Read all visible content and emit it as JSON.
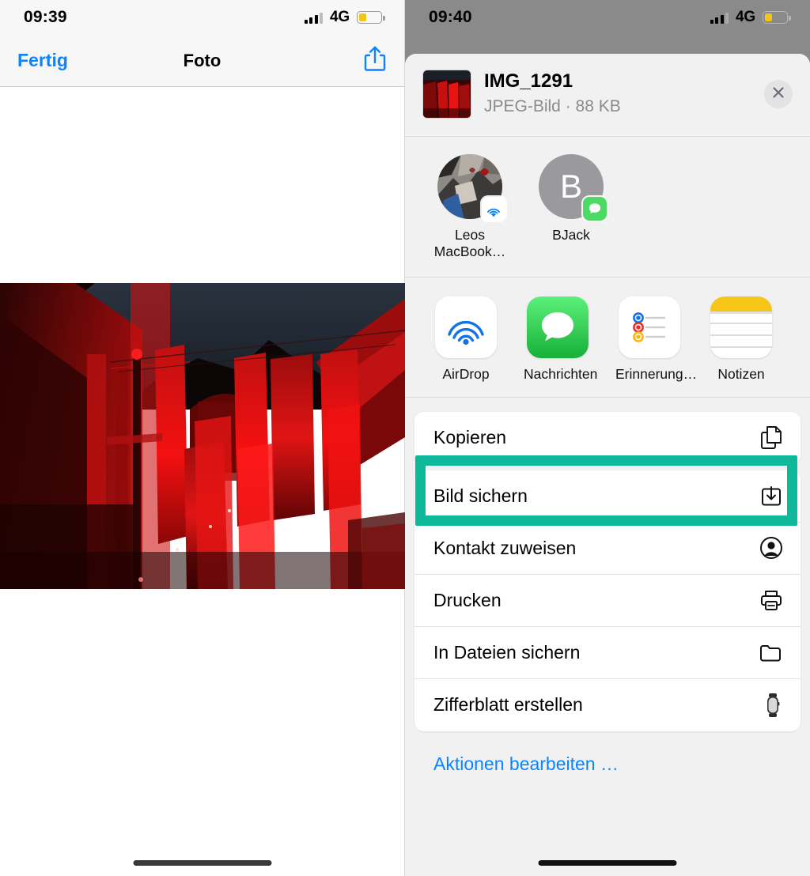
{
  "left_screen": {
    "status_bar": {
      "time": "09:39",
      "carrier": "4G",
      "signal_bars": 4,
      "signal_bars_filled": 3,
      "battery_percent": 36,
      "battery_color": "#f5c516"
    },
    "nav_bar": {
      "done_label": "Fertig",
      "title": "Foto",
      "share_icon": "share-icon"
    },
    "photo": {
      "alt": "Nachtaufnahme einer Gasse mit rot beleuchteten Stoffbahnen",
      "icon": "photo-image"
    },
    "home_indicator": "home-indicator"
  },
  "right_screen": {
    "status_bar": {
      "time": "09:40",
      "carrier": "4G",
      "signal_bars": 4,
      "signal_bars_filled": 3,
      "battery_percent": 36,
      "battery_color": "#f5c516"
    },
    "share_sheet": {
      "header": {
        "thumbnail_icon": "photo-thumbnail",
        "title": "IMG_1291",
        "subtitle": "JPEG-Bild · 88 KB",
        "close_icon": "close-icon"
      },
      "suggestions": [
        {
          "name": "Leos MacBook…",
          "badge_icon": "airdrop-icon",
          "avatar_type": "photo"
        },
        {
          "name": "BJack",
          "badge_icon": "messages-icon",
          "avatar_type": "initial",
          "initial": "B"
        }
      ],
      "apps": [
        {
          "name": "AirDrop",
          "icon": "airdrop-icon"
        },
        {
          "name": "Nachrichten",
          "icon": "messages-icon"
        },
        {
          "name": "Erinnerung…",
          "icon": "reminders-icon"
        },
        {
          "name": "Notizen",
          "icon": "notes-icon"
        }
      ],
      "actions_group_1": [
        {
          "label": "Kopieren",
          "icon": "copy-icon"
        }
      ],
      "actions_group_2": [
        {
          "label": "Bild sichern",
          "icon": "save-image-icon",
          "highlighted": true
        },
        {
          "label": "Kontakt zuweisen",
          "icon": "contact-icon"
        },
        {
          "label": "Drucken",
          "icon": "printer-icon"
        },
        {
          "label": "In Dateien sichern",
          "icon": "folder-icon"
        },
        {
          "label": "Zifferblatt erstellen",
          "icon": "watch-icon"
        }
      ],
      "edit_actions_label": "Aktionen bearbeiten …",
      "highlight_color": "#0fb79b",
      "accent_color": "#0a84ff"
    },
    "home_indicator": "home-indicator"
  }
}
